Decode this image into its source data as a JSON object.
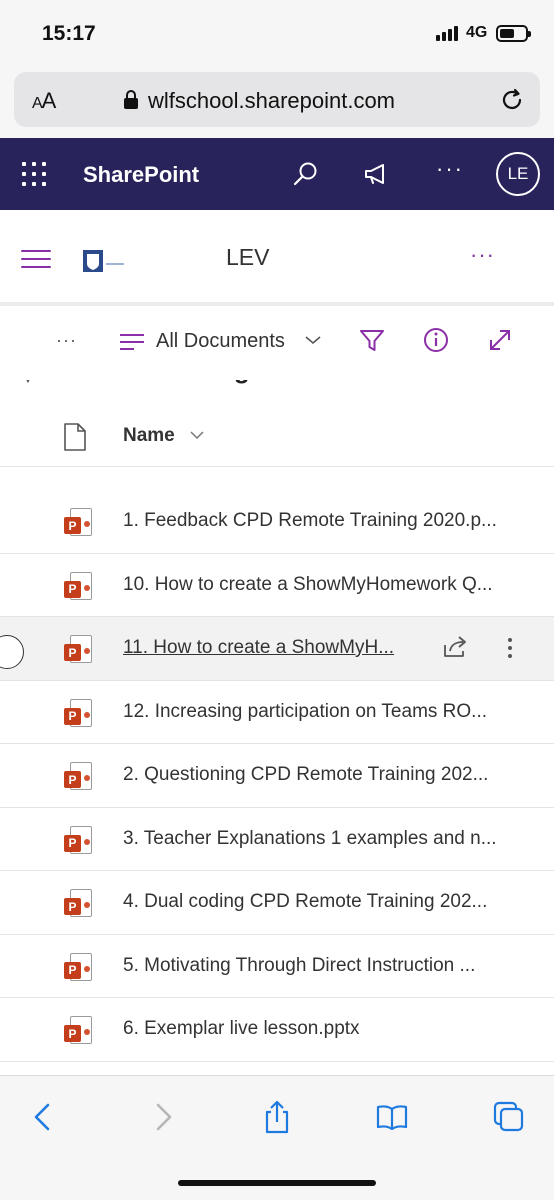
{
  "status_bar": {
    "time": "15:17",
    "network": "4G"
  },
  "browser": {
    "text_size_label": "AA",
    "url": "wlfschool.sharepoint.com"
  },
  "sharepoint": {
    "app_name": "SharePoint",
    "more": "···",
    "avatar_initials": "LE"
  },
  "site": {
    "name": "LEV",
    "more": "···"
  },
  "command_bar": {
    "more": "···",
    "view_label": "All Documents"
  },
  "list": {
    "group_title": "Remote Training",
    "column_name": "Name",
    "items": [
      {
        "name": "1. Feedback CPD Remote Training 2020.p..."
      },
      {
        "name": "10. How to create a ShowMyHomework Q..."
      },
      {
        "name": "11. How to create a ShowMyH..."
      },
      {
        "name": "12. Increasing participation on Teams RO..."
      },
      {
        "name": "2. Questioning CPD Remote Training 202..."
      },
      {
        "name": "3. Teacher Explanations 1 examples and n..."
      },
      {
        "name": "4. Dual coding CPD Remote Training 202..."
      },
      {
        "name": "5. Motivating Through Direct Instruction ..."
      },
      {
        "name": "6. Exemplar live lesson.pptx"
      }
    ],
    "file_badge": "P"
  },
  "colors": {
    "suite_bar": "#28245b",
    "accent": "#8a2fa5",
    "ppt": "#c43e1c",
    "ios_blue": "#1f7ae0"
  }
}
